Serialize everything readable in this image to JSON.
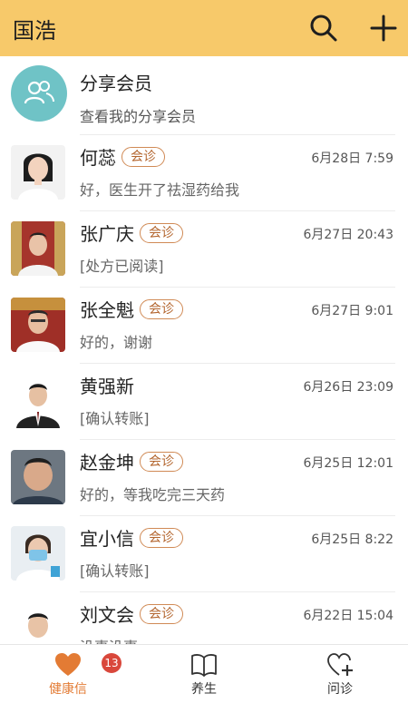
{
  "header": {
    "title": "国浩"
  },
  "share": {
    "title": "分享会员",
    "subtitle": "查看我的分享会员"
  },
  "conversations": [
    {
      "name": "何蕊",
      "badge": "会诊",
      "time": "6月28日 7:59",
      "message": "好，医生开了祛湿药给我"
    },
    {
      "name": "张广庆",
      "badge": "会诊",
      "time": "6月27日 20:43",
      "message": "[处方已阅读]"
    },
    {
      "name": "张全魁",
      "badge": "会诊",
      "time": "6月27日 9:01",
      "message": "好的，谢谢"
    },
    {
      "name": "黄强新",
      "badge": "",
      "time": "6月26日 23:09",
      "message": "[确认转账]"
    },
    {
      "name": "赵金坤",
      "badge": "会诊",
      "time": "6月25日 12:01",
      "message": "好的，等我吃完三天药"
    },
    {
      "name": "宜小信",
      "badge": "会诊",
      "time": "6月25日 8:22",
      "message": "[确认转账]"
    },
    {
      "name": "刘文会",
      "badge": "会诊",
      "time": "6月22日 15:04",
      "message": "没事没事"
    }
  ],
  "tabs": [
    {
      "label": "健康信",
      "active": true
    },
    {
      "label": "养生",
      "active": false
    },
    {
      "label": "问诊",
      "active": false
    }
  ],
  "unread_count": "13",
  "colors": {
    "header": "#f7c96a",
    "accent": "#e37b34",
    "badge": "#d9473b"
  }
}
